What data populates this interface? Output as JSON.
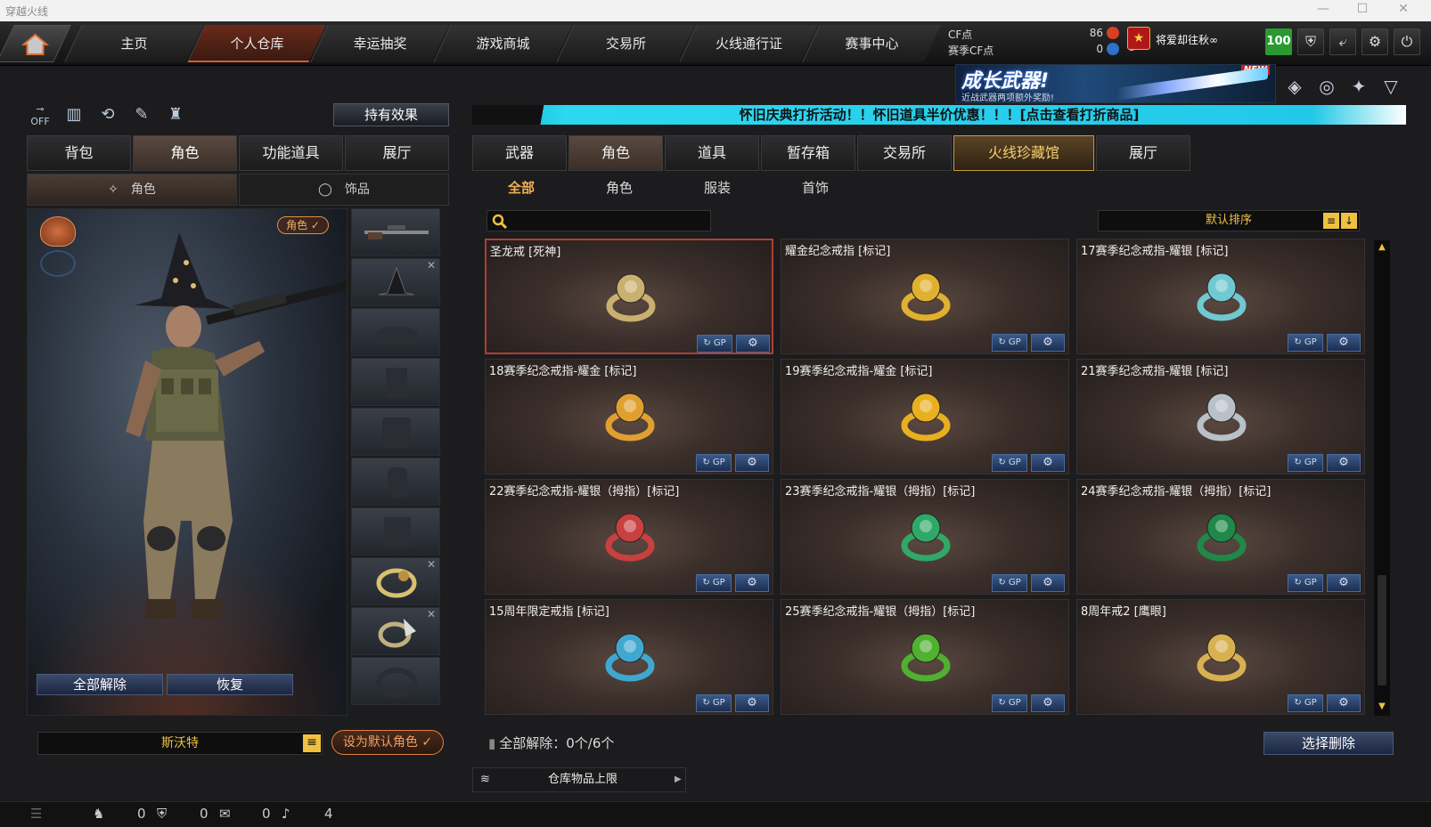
{
  "window": {
    "title": "穿越火线"
  },
  "nav": {
    "tabs": [
      "主页",
      "个人仓库",
      "幸运抽奖",
      "游戏商城",
      "交易所",
      "火线通行证",
      "赛事中心"
    ],
    "active": "个人仓库"
  },
  "currency": {
    "cf_label": "CF点",
    "cf_value": "86",
    "season_label": "赛季CF点",
    "season_value": "0"
  },
  "player": {
    "name": "将爱却往秋∞",
    "level": "100"
  },
  "banner": {
    "title": "成长武器!",
    "subtitle": "近战武器两项额外奖励!",
    "badge": "NEW"
  },
  "promo": {
    "text": "怀旧庆典打折活动！！怀旧道具半价优惠！！！[点击查看打折商品]"
  },
  "left": {
    "hold_effect_label": "持有效果",
    "tabs": [
      "背包",
      "角色",
      "功能道具",
      "展厅"
    ],
    "active_tab": "角色",
    "subtabs": [
      "角色",
      "饰品"
    ],
    "active_subtab": "角色",
    "role_badge": "角色 ✓",
    "release_all_label": "全部解除",
    "restore_label": "恢复",
    "character_name": "斯沃特",
    "set_default_label": "设为默认角色 ✓"
  },
  "right": {
    "tabs": [
      "武器",
      "角色",
      "道具",
      "暂存箱",
      "交易所",
      "火线珍藏馆",
      "展厅"
    ],
    "active_tab": "角色",
    "highlight_tab": "火线珍藏馆",
    "subtabs": [
      "全部",
      "角色",
      "服装",
      "首饰"
    ],
    "active_subtab": "全部",
    "search_placeholder": "",
    "sort_label": "默认排序",
    "items": [
      {
        "name": "圣龙戒 [死神]",
        "color": "#c9b070"
      },
      {
        "name": "耀金纪念戒指 [标记]",
        "color": "#e0b030"
      },
      {
        "name": "17赛季纪念戒指-耀银 [标记]",
        "color": "#70c8d0"
      },
      {
        "name": "18赛季纪念戒指-耀金 [标记]",
        "color": "#e0a030"
      },
      {
        "name": "19赛季纪念戒指-耀金 [标记]",
        "color": "#e8b020"
      },
      {
        "name": "21赛季纪念戒指-耀银  [标记]",
        "color": "#b8c0c8"
      },
      {
        "name": "22赛季纪念戒指-耀银（拇指）[标记]",
        "color": "#c84040"
      },
      {
        "name": "23赛季纪念戒指-耀银（拇指）[标记]",
        "color": "#30a868"
      },
      {
        "name": "24赛季纪念戒指-耀银（拇指）[标记]",
        "color": "#208848"
      },
      {
        "name": "15周年限定戒指 [标记]",
        "color": "#40a8d0"
      },
      {
        "name": "25赛季纪念戒指-耀银（拇指）[标记]",
        "color": "#50b030"
      },
      {
        "name": "8周年戒2 [鹰眼]",
        "color": "#d8b050"
      }
    ],
    "gp_label": "GP",
    "release_info": "全部解除：0个/6个",
    "delete_label": "选择删除",
    "capacity_label": "仓库物品上限"
  },
  "status": {
    "v1": "0",
    "v2": "0",
    "v3": "0",
    "v4": "4"
  }
}
